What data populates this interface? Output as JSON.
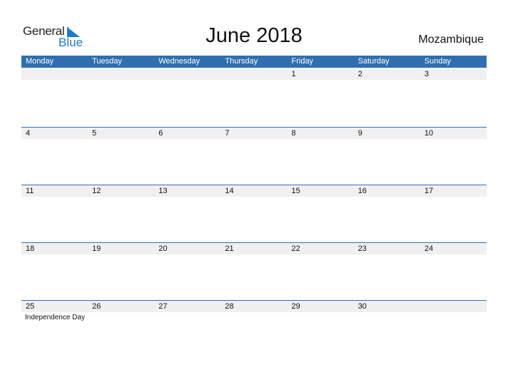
{
  "logo": {
    "word1": "General",
    "word2": "Blue"
  },
  "title": "June 2018",
  "country": "Mozambique",
  "colors": {
    "accent": "#2f6fb0",
    "strip": "#f0f0f0"
  },
  "weekdays": [
    "Monday",
    "Tuesday",
    "Wednesday",
    "Thursday",
    "Friday",
    "Saturday",
    "Sunday"
  ],
  "weeks": [
    [
      "",
      "",
      "",
      "",
      "1",
      "2",
      "3"
    ],
    [
      "4",
      "5",
      "6",
      "7",
      "8",
      "9",
      "10"
    ],
    [
      "11",
      "12",
      "13",
      "14",
      "15",
      "16",
      "17"
    ],
    [
      "18",
      "19",
      "20",
      "21",
      "22",
      "23",
      "24"
    ],
    [
      "25",
      "26",
      "27",
      "28",
      "29",
      "30",
      ""
    ]
  ],
  "holidays": [
    {
      "week": 4,
      "day": 0,
      "name": "Independence Day"
    }
  ]
}
